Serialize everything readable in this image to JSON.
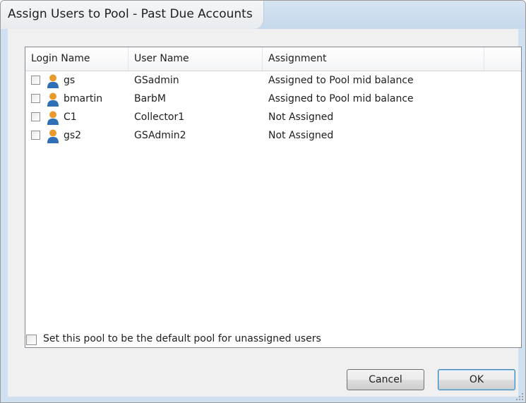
{
  "window": {
    "title": "Assign Users to Pool - Past Due Accounts"
  },
  "list": {
    "columns": [
      "Login Name",
      "User Name",
      "Assignment"
    ],
    "rows": [
      {
        "login": "gs",
        "user": "GSadmin",
        "assignment": "Assigned to Pool mid balance",
        "checked": false,
        "icon": "user-icon"
      },
      {
        "login": "bmartin",
        "user": "BarbM",
        "assignment": "Assigned to Pool mid balance",
        "checked": false,
        "icon": "user-icon"
      },
      {
        "login": "C1",
        "user": "Collector1",
        "assignment": "Not Assigned",
        "checked": false,
        "icon": "user-icon"
      },
      {
        "login": "gs2",
        "user": "GSAdmin2",
        "assignment": "Not Assigned",
        "checked": false,
        "icon": "user-icon"
      }
    ]
  },
  "default_pool": {
    "label": "Set this pool to be the default pool for unassigned users",
    "checked": false
  },
  "buttons": {
    "cancel": "Cancel",
    "ok": "OK"
  },
  "colors": {
    "user_head": "#e89a2c",
    "user_body": "#2f6fb8"
  }
}
